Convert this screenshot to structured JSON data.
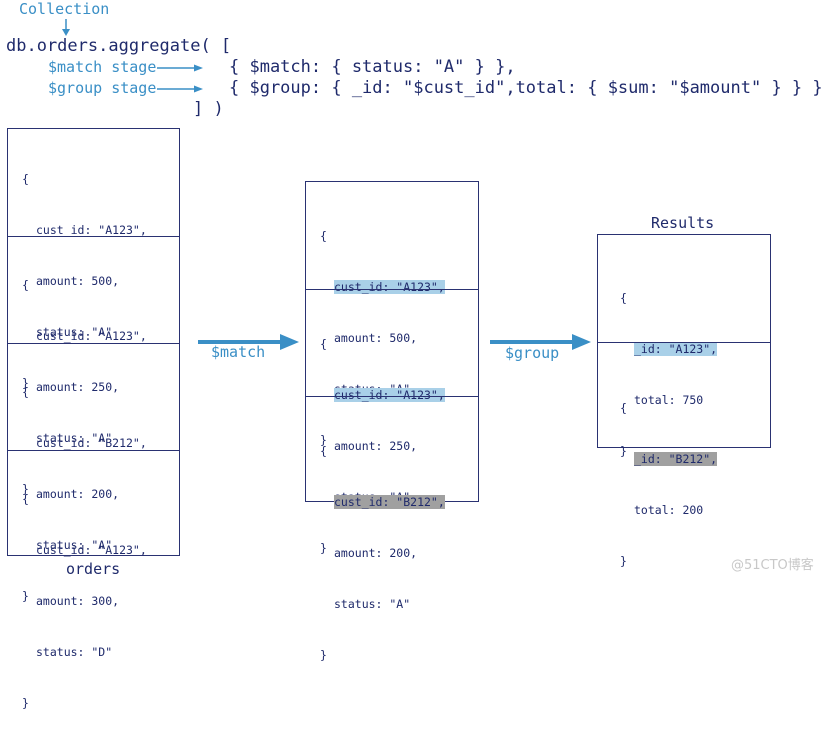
{
  "query": {
    "collection_label": "Collection",
    "line1": "db.orders.aggregate( [",
    "match_stage_label": "$match stage",
    "group_stage_label": "$group stage",
    "match_line": "{ $match: { status: \"A\" } },",
    "group_line": "{ $group: { _id: \"$cust_id\",total: { $sum: \"$amount\" } } }",
    "closing": "] )"
  },
  "orders": {
    "caption": "orders",
    "documents": [
      {
        "open": "{",
        "cust_id": "cust_id: \"A123\",",
        "amount": "amount: 500,",
        "status": "status: \"A\"",
        "close": "}"
      },
      {
        "open": "{",
        "cust_id": "cust_id: \"A123\",",
        "amount": "amount: 250,",
        "status": "status: \"A\"",
        "close": "}"
      },
      {
        "open": "{",
        "cust_id": "cust_id: \"B212\",",
        "amount": "amount: 200,",
        "status": "status: \"A\"",
        "close": "}"
      },
      {
        "open": "{",
        "cust_id": "cust_id: \"A123\",",
        "amount": "amount: 300,",
        "status": "status: \"D\"",
        "close": "}"
      }
    ]
  },
  "match_arrow_label": "$match",
  "matched": {
    "documents": [
      {
        "open": "{",
        "cust_id": "cust_id: \"A123\",",
        "amount": "amount: 500,",
        "status": "status: \"A\"",
        "close": "}",
        "highlight": "blue"
      },
      {
        "open": "{",
        "cust_id": "cust_id: \"A123\",",
        "amount": "amount: 250,",
        "status": "status: \"A\"",
        "close": "}",
        "highlight": "blue"
      },
      {
        "open": "{",
        "cust_id": "cust_id: \"B212\",",
        "amount": "amount: 200,",
        "status": "status: \"A\"",
        "close": "}",
        "highlight": "gray"
      }
    ]
  },
  "group_arrow_label": "$group",
  "results": {
    "caption": "Results",
    "documents": [
      {
        "open": "{",
        "id": "_id: \"A123\",",
        "total": "total: 750",
        "close": "}",
        "highlight": "blue"
      },
      {
        "open": "{",
        "id": "_id: \"B212\",",
        "total": "total: 200",
        "close": "}",
        "highlight": "gray"
      }
    ]
  },
  "colors": {
    "accent_blue": "#3a8fc6",
    "text_navy": "#1f2a6b",
    "highlight_blue": "#a9d0e8",
    "highlight_gray": "#a0a0a0"
  },
  "watermark": "@51CTO博客"
}
